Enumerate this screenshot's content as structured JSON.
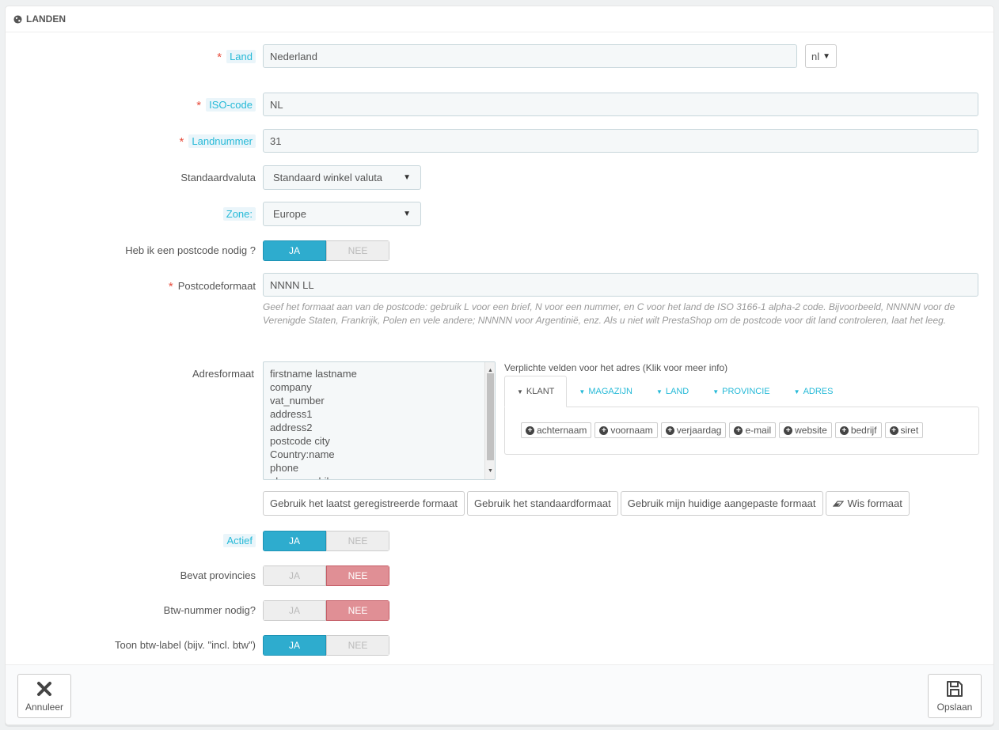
{
  "panel": {
    "title": "LANDEN",
    "icon": "globe-icon"
  },
  "form": {
    "country": {
      "label": "Land",
      "value": "Nederland",
      "lang": "nl",
      "required": true
    },
    "iso_code": {
      "label": "ISO-code",
      "value": "NL",
      "required": true
    },
    "call_prefix": {
      "label": "Landnummer",
      "value": "31",
      "required": true
    },
    "currency": {
      "label": "Standaardvaluta",
      "selected": "Standaard winkel valuta"
    },
    "zone": {
      "label": "Zone:",
      "selected": "Europe"
    },
    "need_zip": {
      "label": "Heb ik een postcode nodig ?",
      "yes": "JA",
      "no": "NEE",
      "value": "JA"
    },
    "zip_format": {
      "label": "Postcodeformaat",
      "value": "NNNN LL",
      "required": true,
      "help": "Geef het formaat aan van de postcode: gebruik L voor een brief, N voor een nummer, en C voor het land de ISO 3166-1 alpha-2 code. Bijvoorbeeld, NNNNN voor de Verenigde Staten, Frankrijk, Polen en vele andere; NNNNN voor Argentinië, enz. Als u niet wilt PrestaShop om de postcode voor dit land controleren, laat het leeg."
    },
    "address_format": {
      "label": "Adresformaat",
      "lines": [
        "firstname lastname",
        "company",
        "vat_number",
        "address1",
        "address2",
        "postcode city",
        "Country:name",
        "phone",
        "phone_mobile"
      ]
    },
    "required_fields": {
      "title": "Verplichte velden voor het adres (Klik voor meer info)",
      "tabs": [
        "KLANT",
        "MAGAZIJN",
        "LAND",
        "PROVINCIE",
        "ADRES"
      ],
      "active_tab": "KLANT",
      "chips": [
        "achternaam",
        "voornaam",
        "verjaardag",
        "e-mail",
        "website",
        "bedrijf",
        "siret"
      ]
    },
    "format_buttons": {
      "last_saved": "Gebruik het laatst geregistreerde formaat",
      "default": "Gebruik het standaardformaat",
      "current": "Gebruik mijn huidige aangepaste formaat",
      "clear": "Wis formaat"
    },
    "active": {
      "label": "Actief",
      "yes": "JA",
      "no": "NEE",
      "value": "JA"
    },
    "contains_states": {
      "label": "Bevat provincies",
      "yes": "JA",
      "no": "NEE",
      "value": "NEE"
    },
    "need_vat": {
      "label": "Btw-nummer nodig?",
      "yes": "JA",
      "no": "NEE",
      "value": "NEE"
    },
    "display_tax_label": {
      "label": "Toon btw-label (bijv. \"incl. btw\")",
      "yes": "JA",
      "no": "NEE",
      "value": "JA"
    }
  },
  "footer": {
    "cancel": "Annuleer",
    "save": "Opslaan"
  },
  "colors": {
    "accent": "#25b9d7",
    "switch_on": "#2eacce",
    "switch_off": "#e08f95",
    "required": "#e74c3c"
  }
}
